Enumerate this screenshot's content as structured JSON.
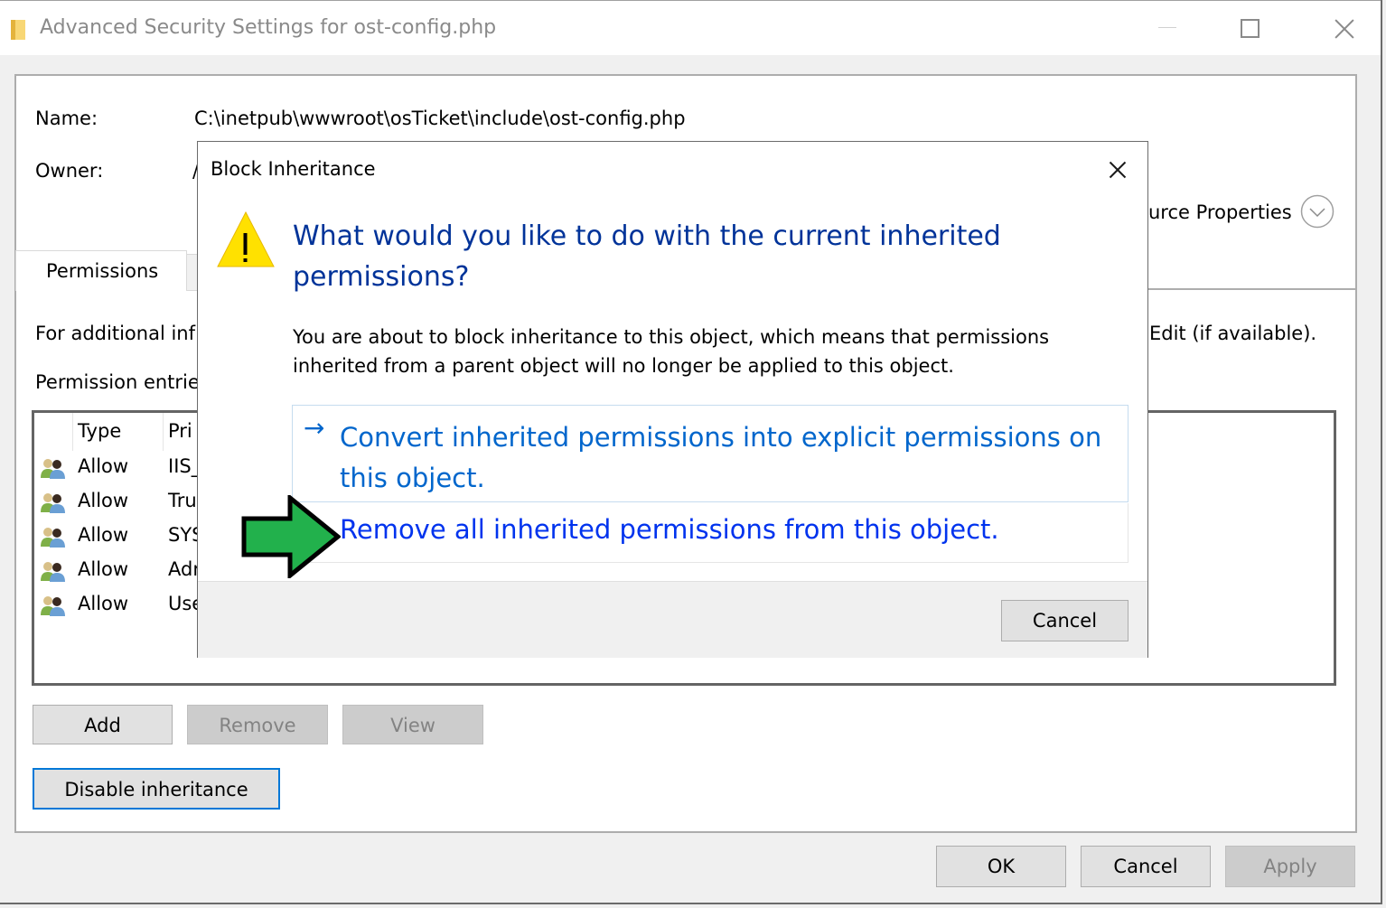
{
  "window": {
    "title": "Advanced Security Settings for ost-config.php",
    "controls": [
      "minimize",
      "maximize",
      "close"
    ]
  },
  "details": {
    "name_label": "Name:",
    "name_value": "C:\\inetpub\\wwwroot\\osTicket\\include\\ost-config.php",
    "owner_label": "Owner:",
    "owner_value_partial": "/",
    "resource_properties_partial": "urce Properties"
  },
  "tabs": [
    {
      "label": "Permissions",
      "selected": true
    }
  ],
  "permissions_tab": {
    "info_text_partial": "For additional inf",
    "info_text_right_partial": "Edit (if available).",
    "entries_label_partial": "Permission entrie",
    "table": {
      "columns": [
        "Type",
        "Pri"
      ],
      "rows": [
        {
          "type": "Allow",
          "principal_partial": "IIS_"
        },
        {
          "type": "Allow",
          "principal_partial": "Tru"
        },
        {
          "type": "Allow",
          "principal_partial": "SYS"
        },
        {
          "type": "Allow",
          "principal_partial": "Adr"
        },
        {
          "type": "Allow",
          "principal_partial": "Use"
        }
      ]
    },
    "buttons": {
      "add": "Add",
      "remove": "Remove",
      "view": "View",
      "disable_inheritance": "Disable inheritance"
    }
  },
  "footer_buttons": {
    "ok": "OK",
    "cancel": "Cancel",
    "apply": "Apply"
  },
  "modal": {
    "title": "Block Inheritance",
    "question": "What would you like to do with the current inherited permissions?",
    "body": "You are about to block inheritance to this object, which means that permissions inherited from a parent object will no longer be applied to this object.",
    "option_convert": "Convert inherited permissions into explicit permissions on this object.",
    "option_remove": "Remove all inherited permissions from this object.",
    "cancel": "Cancel"
  },
  "colors": {
    "link_blue": "#0066cc",
    "link_blue_hover": "#0033ee",
    "heading_blue": "#003399",
    "focus_blue": "#0078d7",
    "annotation_arrow_green": "#22b14c"
  }
}
